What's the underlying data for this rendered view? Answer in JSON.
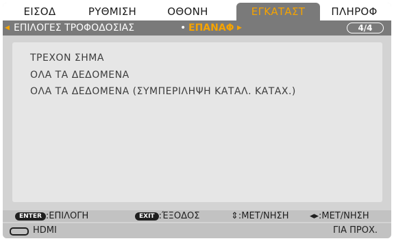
{
  "tabs": [
    "ΕΙΣΟΔ",
    "ΡΥΘΜΙΣΗ",
    "ΟΘΟΝΗ",
    "ΕΓΚΑΤΑΣΤ",
    "ΠΛΗΡΟΦ"
  ],
  "active_tab": "ΕΓΚΑΤΑΣΤ",
  "breadcrumb": {
    "prev": "ΕΠΙΛΟΓΕΣ ΤΡΟΦΟΔΟΣΙΑΣ",
    "current": "ΕΠΑΝΑΦ",
    "page": "4/4"
  },
  "options": [
    "ΤΡΕΧΟΝ ΣΗΜΑ",
    "ΟΛΑ ΤΑ ΔΕΔΟΜΕΝΑ",
    "ΟΛΑ ΤΑ ΔΕΔΟΜΕΝΑ (ΣΥΜΠΕΡΙΛΗΨΗ ΚΑΤΑΛ. ΚΑΤΑΧ.)"
  ],
  "help": {
    "enter_key": "ENTER",
    "enter_label": ":ΕΠΙΛΟΓΗ",
    "exit_key": "EXIT",
    "exit_label": ":ΈΞΟΔΟΣ",
    "updown_label": "⇕:ΜΕΤ/ΝΗΣΗ",
    "leftright_label": "◂▸:ΜΕΤ/ΝΗΣΗ"
  },
  "status": {
    "source": "HDMI",
    "right_text": "ΓΙΑ ΠΡΟΧ."
  },
  "colors": {
    "accent": "#f5a300",
    "tab_active_bg": "#7a7a7a",
    "panel_bg": "#d3d3d3"
  },
  "icons": [
    "left-arrow-icon",
    "right-arrow-icon",
    "hdmi-icon"
  ]
}
